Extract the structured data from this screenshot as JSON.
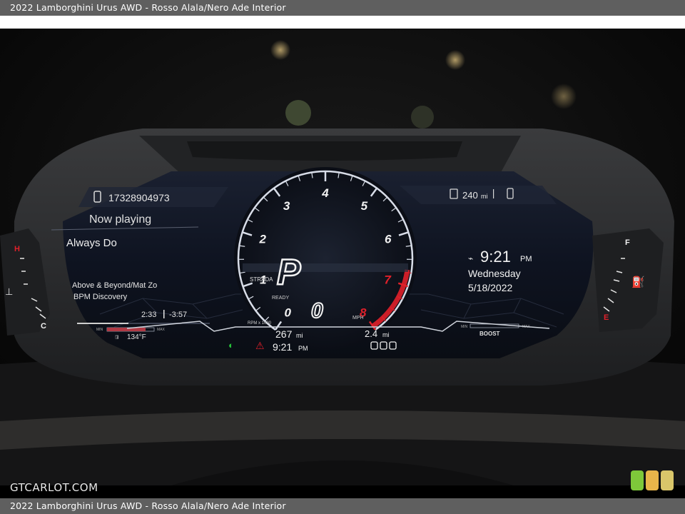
{
  "caption": "2022 Lamborghini Urus AWD - Rosso Alala/Nero Ade Interior",
  "watermark": "GTCARLOT.COM",
  "cluster": {
    "phone": "17328904973",
    "media_header": "Now playing",
    "song": "Always Do",
    "artist": "Above & Beyond/Mat Zo",
    "album": "BPM Discovery",
    "elapsed": "2:33",
    "remaining": "-3:57",
    "oil_temp": "134°F",
    "range_top": "240",
    "range_top_unit": "mi",
    "clock": "9:21",
    "clock_ampm": "PM",
    "day": "Wednesday",
    "date": "5/18/2022",
    "gear": "P",
    "drive_mode": "STRADA",
    "ready": "READY",
    "speed": "0",
    "speed_unit": "MPH",
    "rpm_label": "RPM x 1000",
    "rpm_ticks": [
      "0",
      "1",
      "2",
      "3",
      "4",
      "5",
      "6",
      "7",
      "8"
    ],
    "odo_range": "267",
    "odo_unit": "mi",
    "small_clock": "9:21",
    "small_clock_ampm": "PM",
    "trip_value": "2.4",
    "trip_unit": "mi",
    "boost_label": "BOOST",
    "min_label": "MIN",
    "max_label": "MAX",
    "temp_hot": "H",
    "temp_cold": "C",
    "fuel_full": "F",
    "fuel_empty": "E"
  },
  "colors": {
    "accent_red": "#e0202a",
    "screen_bg": "#0c1018",
    "bezel": "#2b2c2e",
    "indicator_green": "#26c43a"
  }
}
